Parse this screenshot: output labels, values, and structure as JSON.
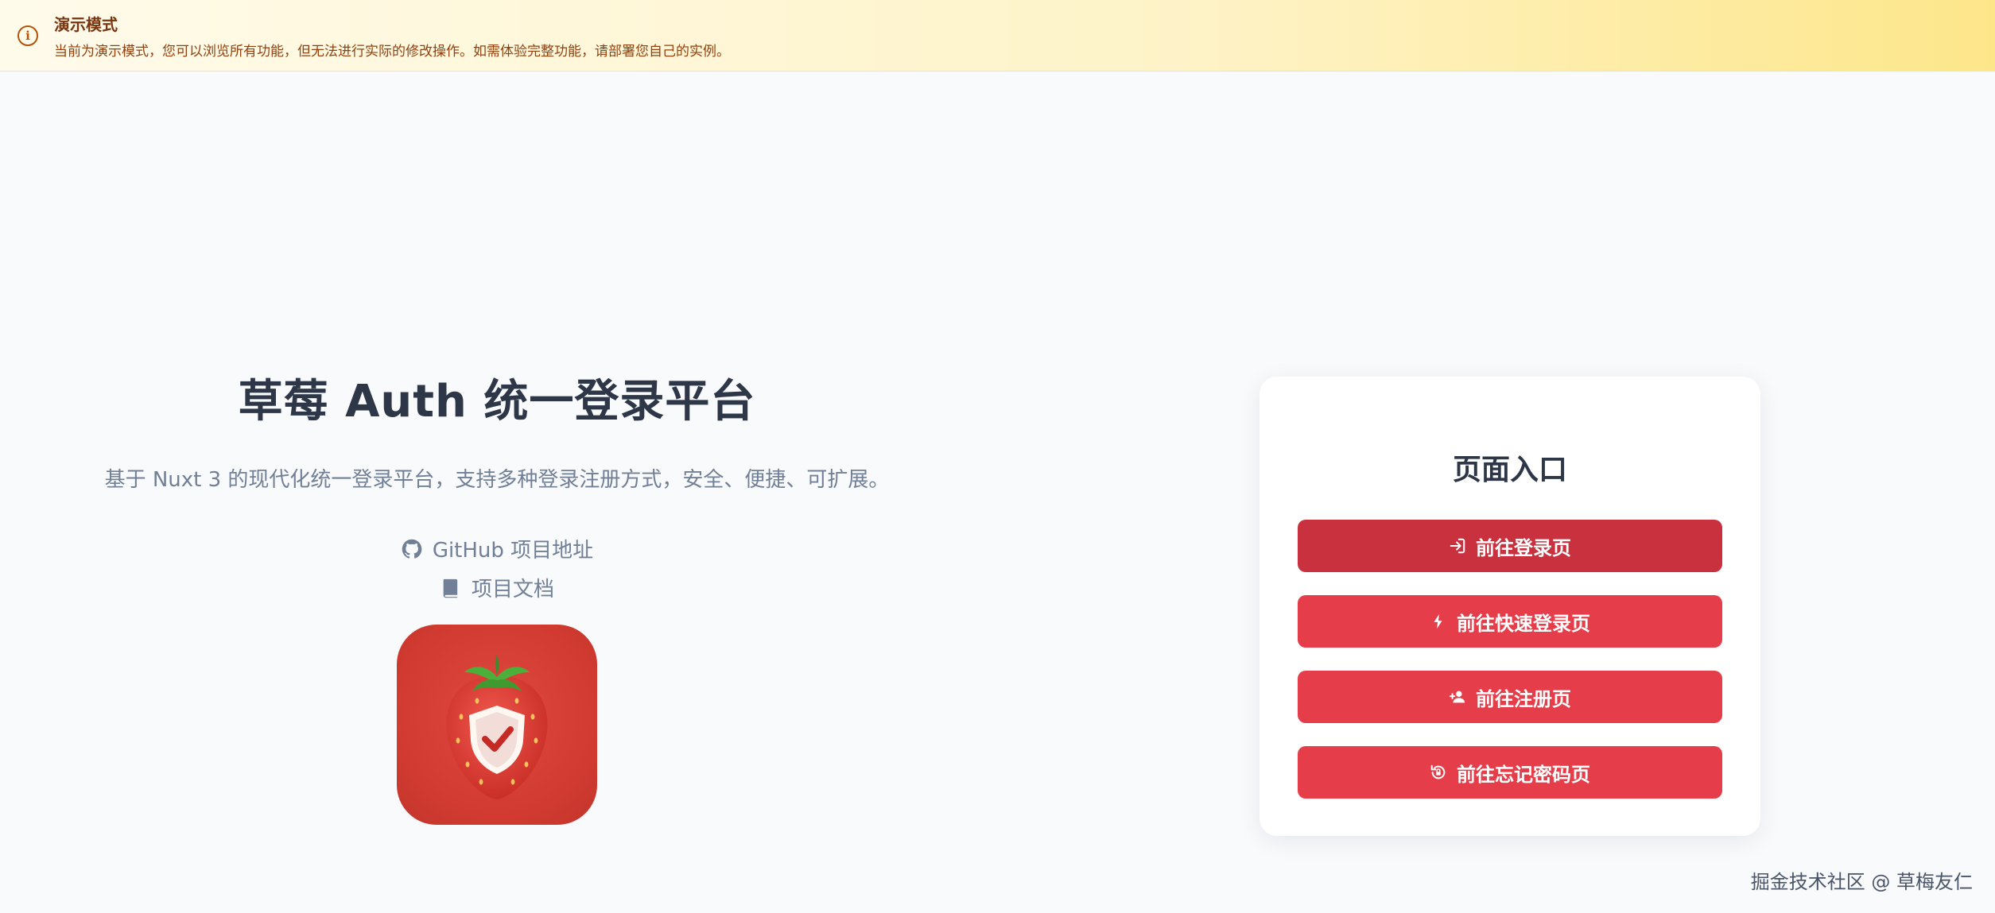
{
  "banner": {
    "title": "演示模式",
    "description": "当前为演示模式，您可以浏览所有功能，但无法进行实际的修改操作。如需体验完整功能，请部署您自己的实例。",
    "icon": "info-icon"
  },
  "hero": {
    "title": "草莓 Auth 统一登录平台",
    "subtitle": "基于 Nuxt 3 的现代化统一登录平台，支持多种登录注册方式，安全、便捷、可扩展。",
    "links": [
      {
        "label": "GitHub 项目地址",
        "icon": "github-icon"
      },
      {
        "label": "项目文档",
        "icon": "book-icon"
      }
    ],
    "logo": "strawberry-shield-logo"
  },
  "entry_card": {
    "title": "页面入口",
    "buttons": [
      {
        "label": "前往登录页",
        "icon": "login-icon"
      },
      {
        "label": "前往快速登录页",
        "icon": "bolt-icon"
      },
      {
        "label": "前往注册页",
        "icon": "user-plus-icon"
      },
      {
        "label": "前往忘记密码页",
        "icon": "lock-reset-icon"
      }
    ]
  },
  "watermark": "掘金技术社区 @ 草梅友仁",
  "colors": {
    "primary": "#e53e4a",
    "primary_active": "#c9313e",
    "banner_bg": "#fef3c7",
    "banner_text": "#92400e",
    "page_bg": "#f8fafc"
  }
}
